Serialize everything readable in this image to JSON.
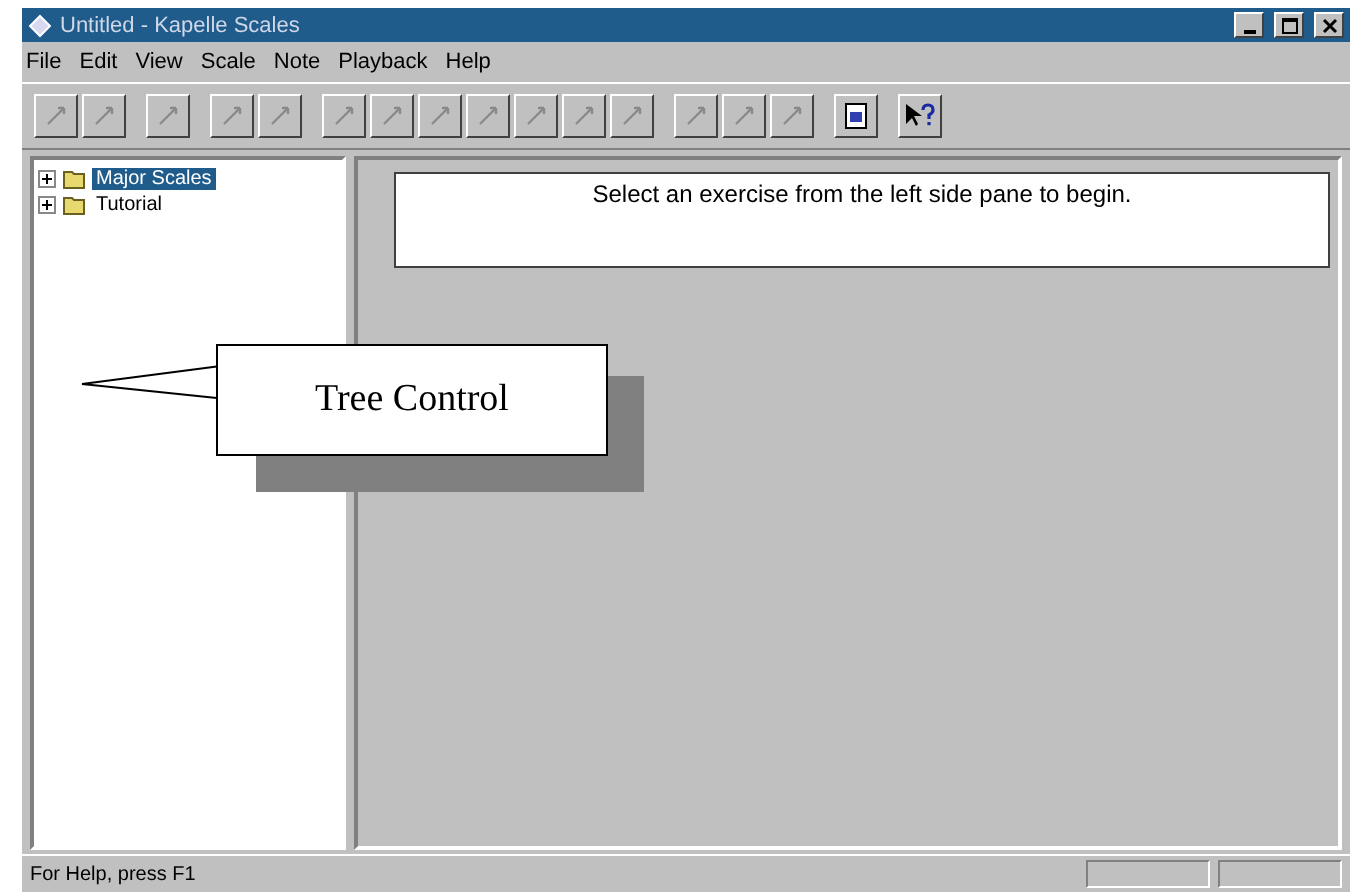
{
  "window": {
    "title": "Untitled - Kapelle Scales"
  },
  "menu": [
    "File",
    "Edit",
    "View",
    "Scale",
    "Note",
    "Playback",
    "Help"
  ],
  "tree": [
    {
      "label": "Major Scales",
      "selected": true,
      "expanded": false
    },
    {
      "label": "Tutorial",
      "selected": false,
      "expanded": false
    }
  ],
  "message": "Select an exercise from the left side pane to begin.",
  "callout": {
    "label": "Tree Control"
  },
  "status_bar": {
    "text": "For Help, press F1"
  }
}
